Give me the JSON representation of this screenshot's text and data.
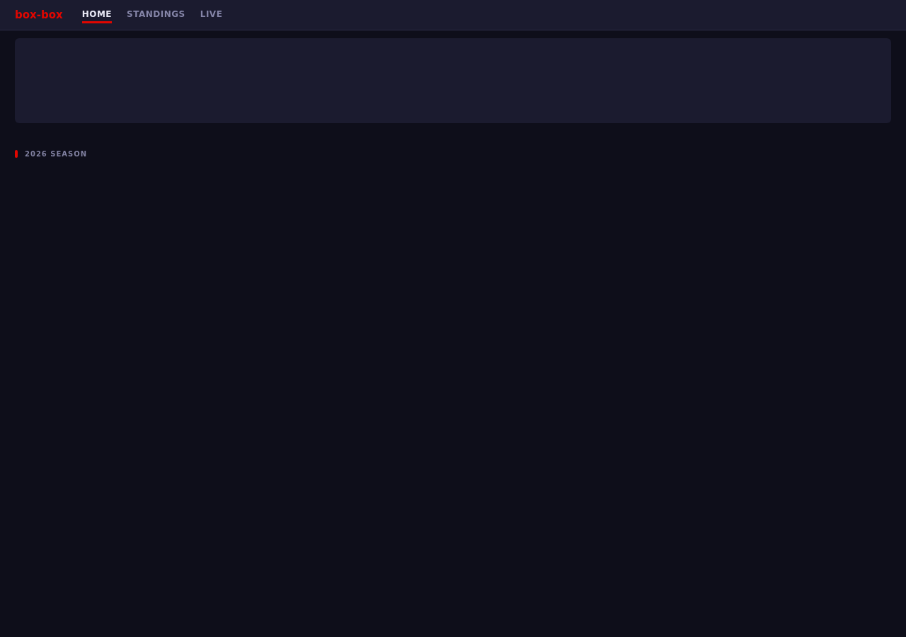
{
  "brand": "box-box",
  "nav": [
    {
      "label": "HOME",
      "selected": true
    },
    {
      "label": "STANDINGS",
      "selected": false
    },
    {
      "label": "LIVE",
      "selected": false
    }
  ],
  "section": {
    "title": "2026 SEASON"
  }
}
